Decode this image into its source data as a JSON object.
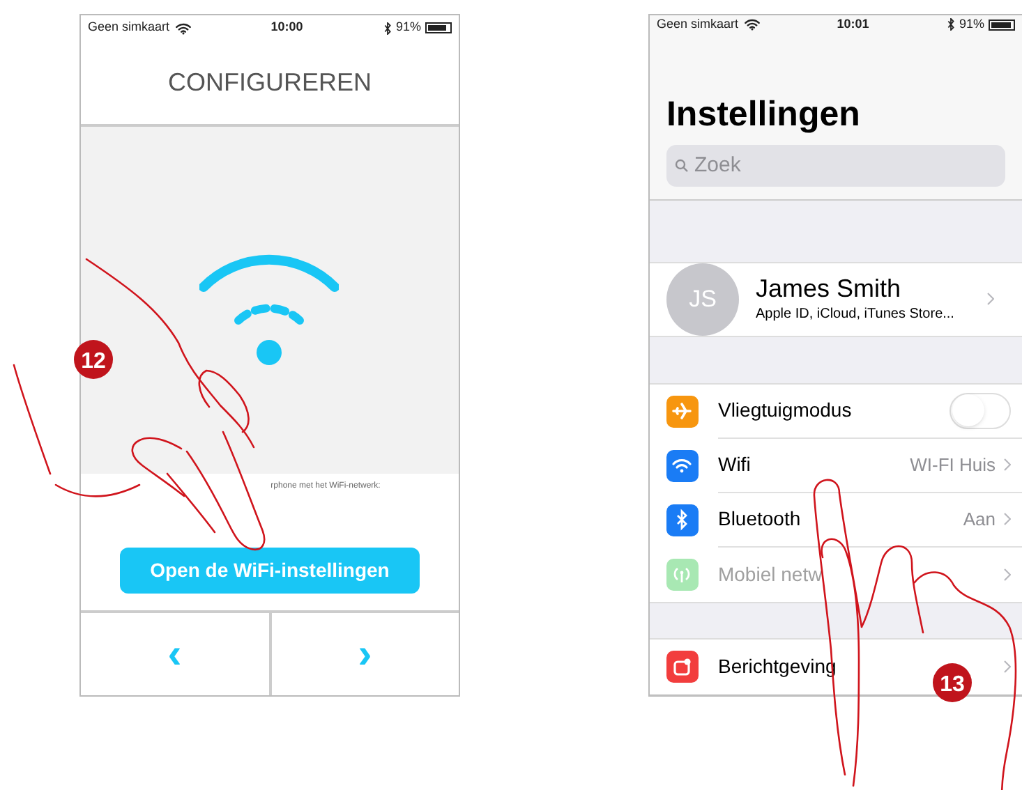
{
  "left_screen": {
    "status_bar": {
      "carrier": "Geen simkaart",
      "time": "10:00",
      "battery": "91%"
    },
    "title": "CONFIGUREREN",
    "instruction": "rphone met het WiFi-netwerk:",
    "button": "Open de WiFi-instellingen",
    "nav": [
      {
        "label": "‹"
      },
      {
        "label": "›"
      }
    ]
  },
  "right_screen": {
    "status_bar": {
      "carrier": "Geen simkaart",
      "time": "10:01",
      "battery": "91%"
    },
    "title": "Instellingen",
    "search": {
      "placeholder": "Zoek"
    },
    "profile": {
      "initials": "JS",
      "name": "James Smith",
      "subtitle": "Apple ID, iCloud, iTunes Store..."
    },
    "rows": [
      {
        "kind": "toggle",
        "label": "Vliegtuigmodus",
        "on": false,
        "color": "#f7960f"
      },
      {
        "kind": "value",
        "label": "Wifi",
        "value": "WI-FI Huis",
        "color": "#1a7cf5"
      },
      {
        "kind": "value",
        "label": "Bluetooth",
        "value": "Aan",
        "color": "#1a7cf5"
      },
      {
        "kind": "value",
        "label": "Mobiel netw",
        "disabled": true,
        "color": "#a8e8b3"
      },
      {
        "kind": "gap"
      },
      {
        "kind": "value",
        "label": "Berichtgeving",
        "color": "#f23d3d"
      }
    ]
  },
  "steps": [
    "12",
    "13"
  ]
}
